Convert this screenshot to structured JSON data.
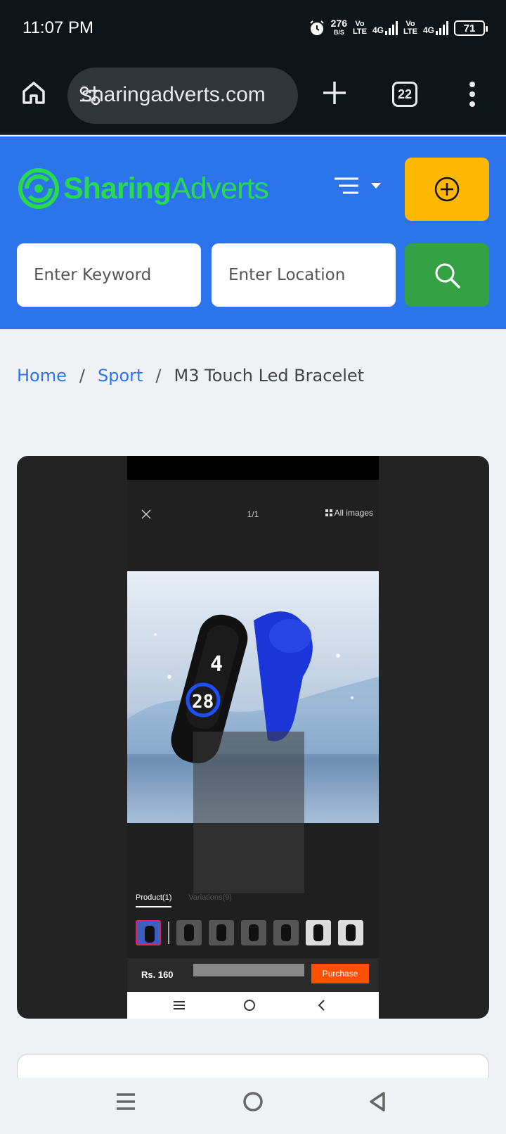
{
  "status_bar": {
    "time": "11:07 PM",
    "data_rate": "276",
    "data_rate_unit": "B/S",
    "volte1": "Vo\nLTE",
    "net1": "4G",
    "volte2": "Vo\nLTE",
    "net2": "4G",
    "battery": "71"
  },
  "browser": {
    "url": "sharingadverts.com",
    "tab_count": "22"
  },
  "site": {
    "logo_bold": "Sharing",
    "logo_light": "Adverts",
    "keyword_placeholder": "Enter Keyword",
    "location_placeholder": "Enter Location"
  },
  "breadcrumb": {
    "home": "Home",
    "category": "Sport",
    "current": "M3 Touch Led Bracelet",
    "separator": "/"
  },
  "product_screenshot": {
    "counter": "1/1",
    "all_images": "All images",
    "tab_product": "Product(1)",
    "tab_variations": "Variations(9)",
    "price": "Rs. 160",
    "purchase": "Purchase"
  },
  "colors": {
    "brand_blue": "#2c74ec",
    "logo_green": "#28d84f",
    "post_yellow": "#ffb800",
    "search_green": "#34a145",
    "purchase_orange": "#ff5000"
  }
}
